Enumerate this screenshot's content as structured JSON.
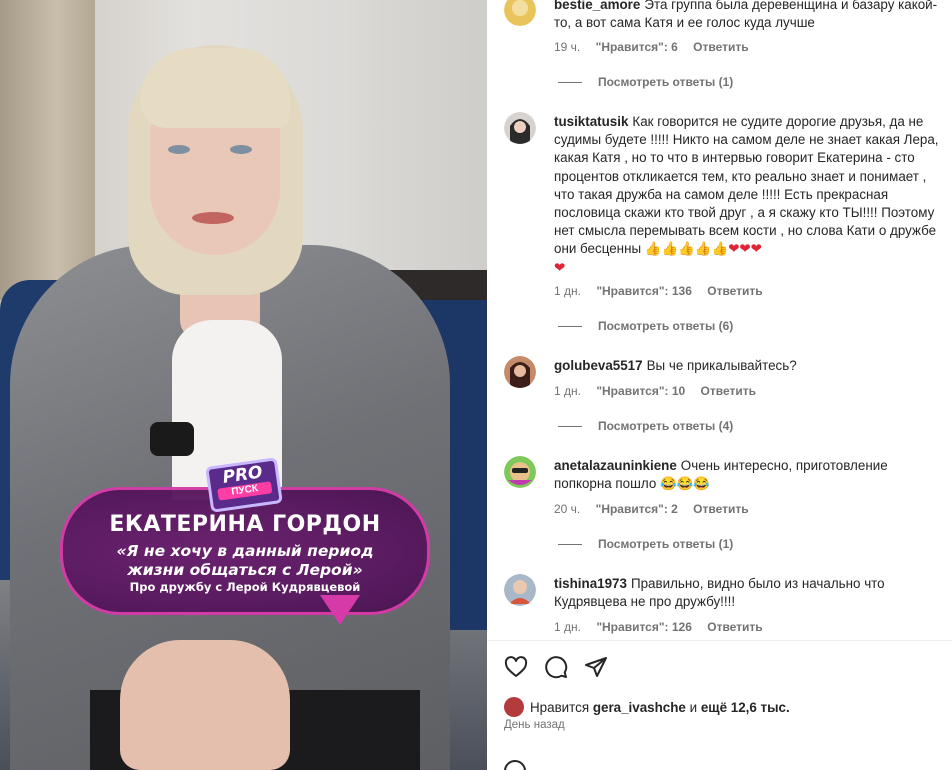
{
  "media": {
    "logo_line1": "PRO",
    "logo_line2": "ПУСК",
    "caption_name": "ЕКАТЕРИНА ГОРДОН",
    "caption_quote_line1": "«Я не хочу в данный период",
    "caption_quote_line2": "жизни общаться с Лерой»",
    "caption_sub": "Про дружбу с Лерой Кудрявцевой"
  },
  "comments": [
    {
      "user": "bestie_amore",
      "text": "Эта группа была деревенщина и базару какой-то, а вот сама Катя и ее голос куда лучше",
      "time": "19 ч.",
      "likes": "\"Нравится\": 6",
      "reply": "Ответить",
      "view_replies": "Посмотреть ответы (1)",
      "avatar_color": "#e9c45a"
    },
    {
      "user": "tusiktatusik",
      "text": "Как говорится не судите дорогие друзья, да не судимы будете !!!!! Никто на самом деле не знает какая Лера, какая Катя , но то что в интервью говорит Екатерина - сто процентов откликается тем, кто реально знает и понимает , что такая дружба на самом деле !!!!! Есть прекрасная пословица скажи кто твой друг , а я скажу кто ТЫ!!!! Поэтому нет смысла перемывать всем кости , но слова Кати о дружбе они бесценны",
      "emoji_thumbs": "👍👍👍👍👍",
      "emoji_hearts": "❤❤❤",
      "emoji_heart_last": "❤",
      "time": "1 дн.",
      "likes": "\"Нравится\": 136",
      "reply": "Ответить",
      "view_replies": "Посмотреть ответы (6)",
      "avatar_color": "#3a3a3a"
    },
    {
      "user": "golubeva5517",
      "text": "Вы че прикалывайтесь?",
      "time": "1 дн.",
      "likes": "\"Нравится\": 10",
      "reply": "Ответить",
      "view_replies": "Посмотреть ответы (4)",
      "avatar_color": "#5b2d2a"
    },
    {
      "user": "anetalazauninkiene",
      "text": "Очень интересно, приготовление попкорна пошло",
      "emoji": "😂😂😂",
      "time": "20 ч.",
      "likes": "\"Нравится\": 2",
      "reply": "Ответить",
      "view_replies": "Посмотреть ответы (1)",
      "avatar_color": "#c9b34a"
    },
    {
      "user": "tishina1973",
      "text": "Правильно, видно было из начально что Кудрявцева не про дружбу!!!!",
      "time": "1 дн.",
      "likes": "\"Нравится\": 126",
      "reply": "Ответить",
      "avatar_color": "#8fa2b5"
    }
  ],
  "footer": {
    "likes_prefix": "Нравится",
    "likes_user": "gera_ivashche",
    "likes_mid": "и",
    "likes_count": "ещё 12,6 тыс.",
    "posted": "День назад"
  },
  "icons": {
    "like": "heart-outline-icon",
    "comment": "speech-bubble-icon",
    "share": "paper-plane-icon"
  }
}
